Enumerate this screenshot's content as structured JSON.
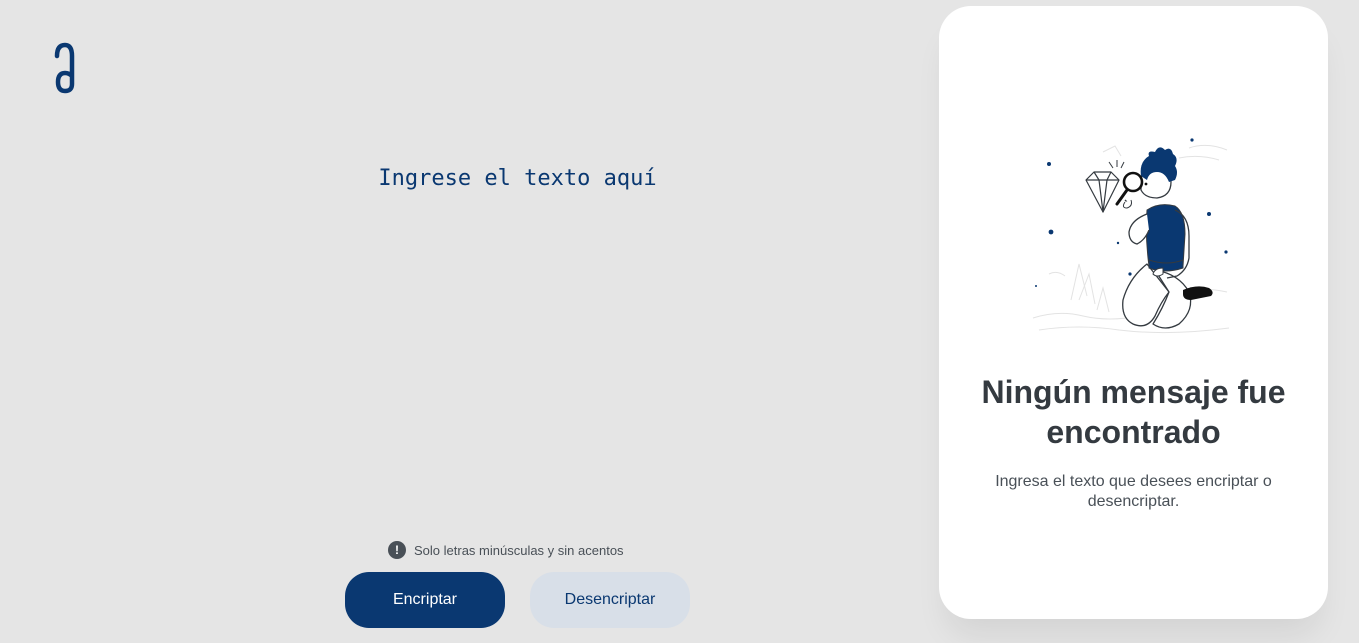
{
  "logo": {
    "icon": "alura-logo-icon"
  },
  "editor": {
    "placeholder": "Ingrese el texto aquí"
  },
  "hint": {
    "icon": "exclamation-circle-icon",
    "text": "Solo letras minúsculas y sin acentos"
  },
  "buttons": {
    "encrypt_label": "Encriptar",
    "decrypt_label": "Desencriptar"
  },
  "output": {
    "illustration": "person-with-magnifying-glass-illustration",
    "title": "Ningún mensaje fue encontrado",
    "message": "Ingresa el texto que desees encriptar o desencriptar."
  },
  "colors": {
    "background": "#e5e5e5",
    "primary": "#0a3871",
    "secondary_button": "#d8dfe8",
    "card": "#ffffff",
    "title_text": "#343a40",
    "body_text": "#495057"
  }
}
